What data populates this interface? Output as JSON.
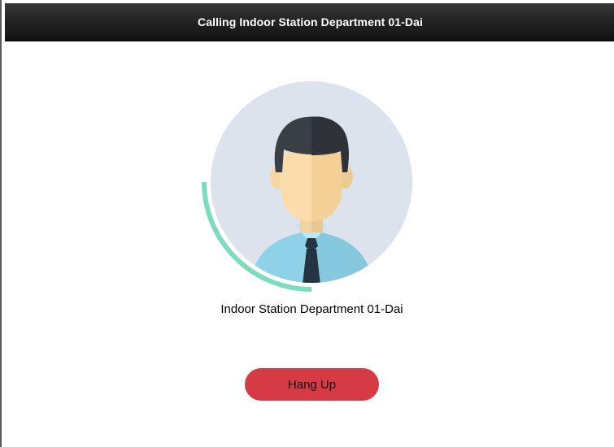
{
  "window": {
    "title": "Calling Indoor Station Department 01-Dai"
  },
  "call": {
    "callee_name": "Indoor Station Department 01-Dai",
    "hang_up_label": "Hang Up",
    "ring_progress": 0.25
  },
  "colors": {
    "avatar_background": "#dce3ec",
    "progress_ring": "#7ddcc0",
    "hang_up_button": "#d63a44"
  },
  "icons": {
    "avatar": "person-avatar-icon"
  }
}
